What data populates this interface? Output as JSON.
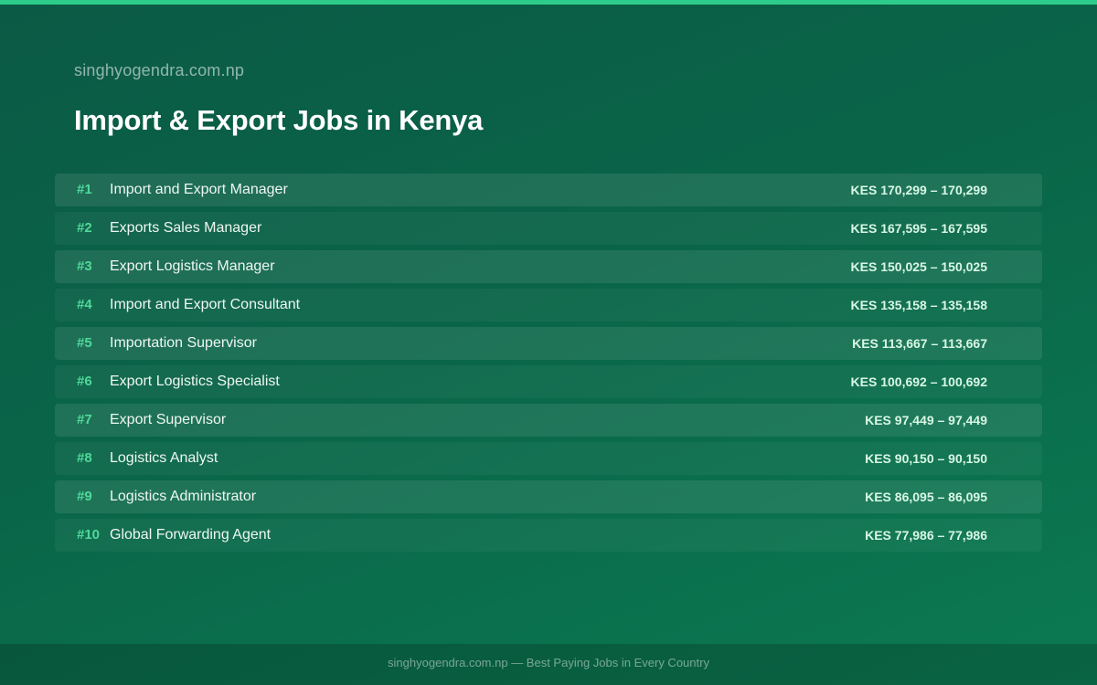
{
  "header": {
    "site_name": "singhyogendra.com.np",
    "title": "Import & Export Jobs in Kenya"
  },
  "jobs": [
    {
      "rank": "#1",
      "title": "Import and Export Manager",
      "salary": "KES 170,299 – 170,299"
    },
    {
      "rank": "#2",
      "title": "Exports Sales Manager",
      "salary": "KES 167,595 – 167,595"
    },
    {
      "rank": "#3",
      "title": "Export Logistics Manager",
      "salary": "KES 150,025 – 150,025"
    },
    {
      "rank": "#4",
      "title": "Import and Export Consultant",
      "salary": "KES 135,158 – 135,158"
    },
    {
      "rank": "#5",
      "title": "Importation Supervisor",
      "salary": "KES 113,667 – 113,667"
    },
    {
      "rank": "#6",
      "title": "Export Logistics Specialist",
      "salary": "KES 100,692 – 100,692"
    },
    {
      "rank": "#7",
      "title": "Export Supervisor",
      "salary": "KES 97,449 – 97,449"
    },
    {
      "rank": "#8",
      "title": "Logistics Analyst",
      "salary": "KES 90,150 – 90,150"
    },
    {
      "rank": "#9",
      "title": "Logistics Administrator",
      "salary": "KES 86,095 – 86,095"
    },
    {
      "rank": "#10",
      "title": "Global Forwarding Agent",
      "salary": "KES 77,986 – 77,986"
    }
  ],
  "footer": {
    "text": "singhyogendra.com.np — Best Paying Jobs in Every Country"
  },
  "colors": {
    "accent": "#2ecc8a",
    "rank": "#4fd99a",
    "background": "#0a6548"
  }
}
